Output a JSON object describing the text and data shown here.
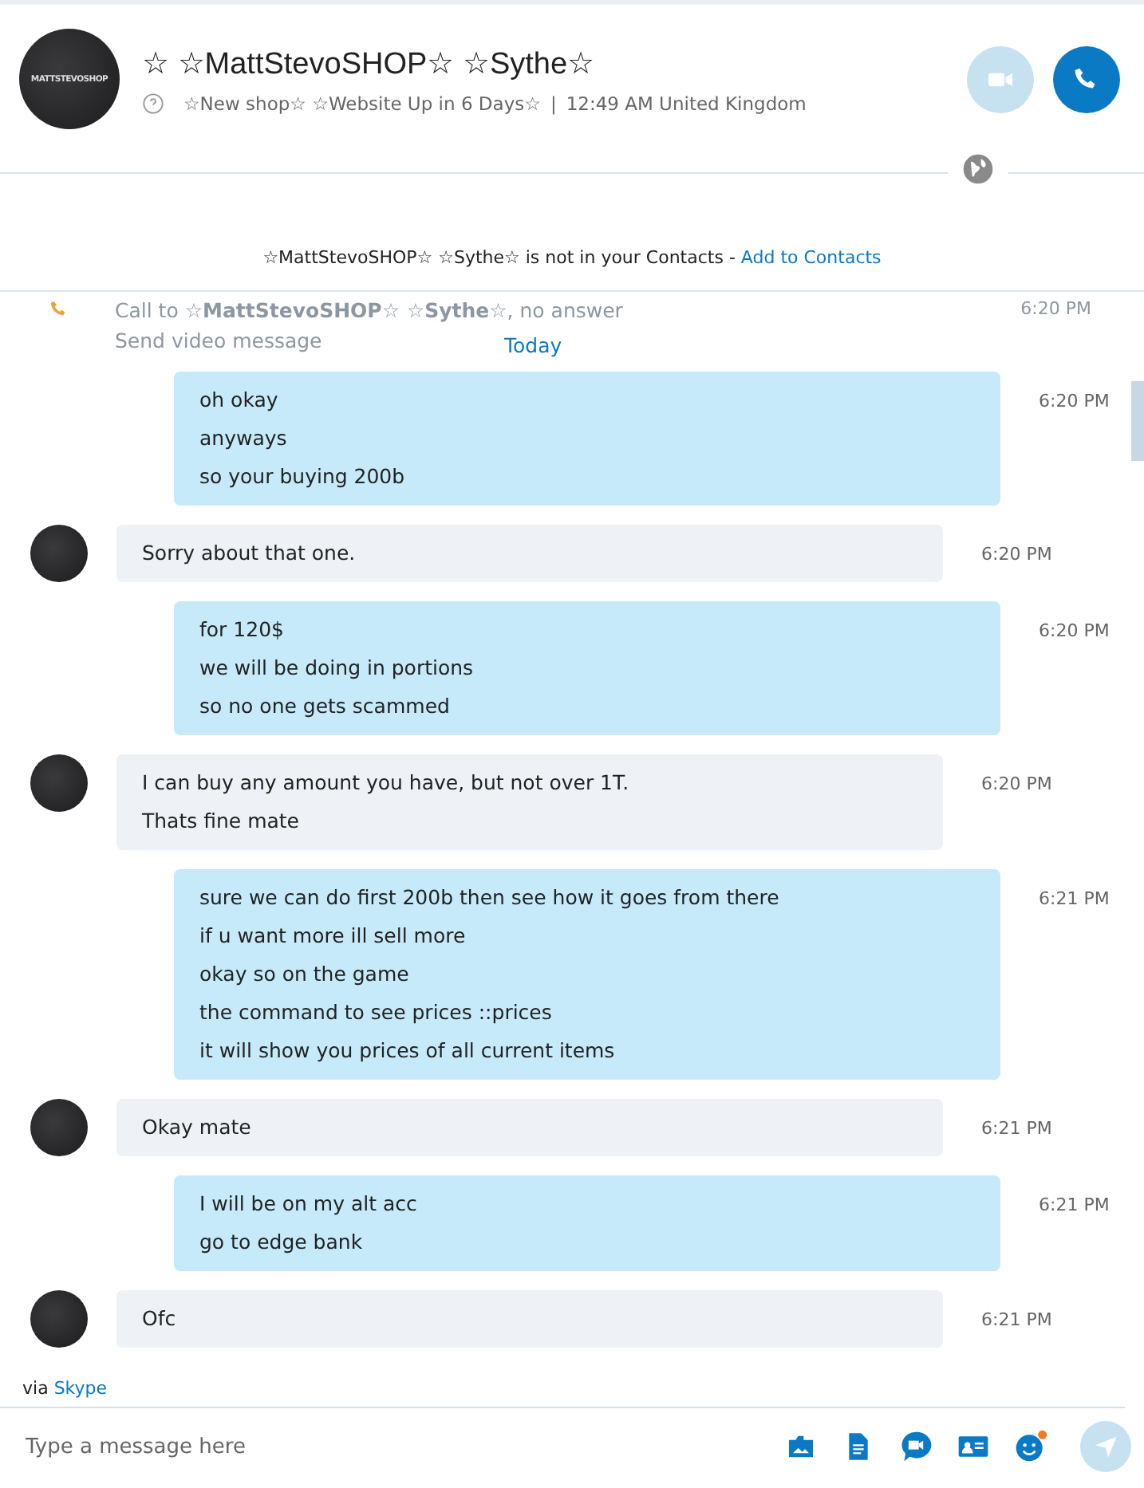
{
  "header": {
    "title": "☆ ☆MattStevoSHOP☆ ☆Sythe☆",
    "mood": "☆New shop☆ ☆Website Up in 6 Days☆",
    "separator": "|",
    "local_time": "12:49 AM United Kingdom",
    "avatar_text": "MATTSTEVOSHOP"
  },
  "notice": {
    "text": "☆MattStevoSHOP☆ ☆Sythe☆ is not in your Contacts - ",
    "link": "Add to Contacts"
  },
  "call_event": {
    "text": "Call to **☆MattStevoSHOP☆ ☆Sythe☆**, no answer",
    "action": "Send video message",
    "time": "6:20 PM"
  },
  "day_label": "Today",
  "messages": [
    {
      "kind": "outgoing",
      "lines": [
        "oh okay",
        "anyways",
        "so your buying 200b"
      ],
      "time": "6:20 PM"
    },
    {
      "kind": "incoming",
      "lines": [
        "Sorry about that one."
      ],
      "time": "6:20 PM"
    },
    {
      "kind": "outgoing",
      "lines": [
        "for 120$",
        "we will be doing in portions",
        "so no one gets scammed"
      ],
      "time": "6:20 PM"
    },
    {
      "kind": "incoming",
      "lines": [
        "I can buy any amount you have, but not over 1T.",
        "Thats fine mate"
      ],
      "time": "6:20 PM"
    },
    {
      "kind": "outgoing",
      "lines": [
        "sure we can do first 200b then see how it goes from there",
        "if u want more ill sell more",
        "okay so on the game",
        "the command to see prices ::prices",
        "it will show you prices of all current items"
      ],
      "time": "6:21 PM"
    },
    {
      "kind": "incoming",
      "lines": [
        "Okay mate"
      ],
      "time": "6:21 PM"
    },
    {
      "kind": "outgoing",
      "lines": [
        "I will be on my alt acc",
        "go to edge bank"
      ],
      "time": "6:21 PM"
    },
    {
      "kind": "incoming",
      "lines": [
        "Ofc"
      ],
      "time": "6:21 PM"
    }
  ],
  "footer": {
    "via": "via",
    "via_link": "Skype",
    "placeholder": "Type a message here"
  }
}
